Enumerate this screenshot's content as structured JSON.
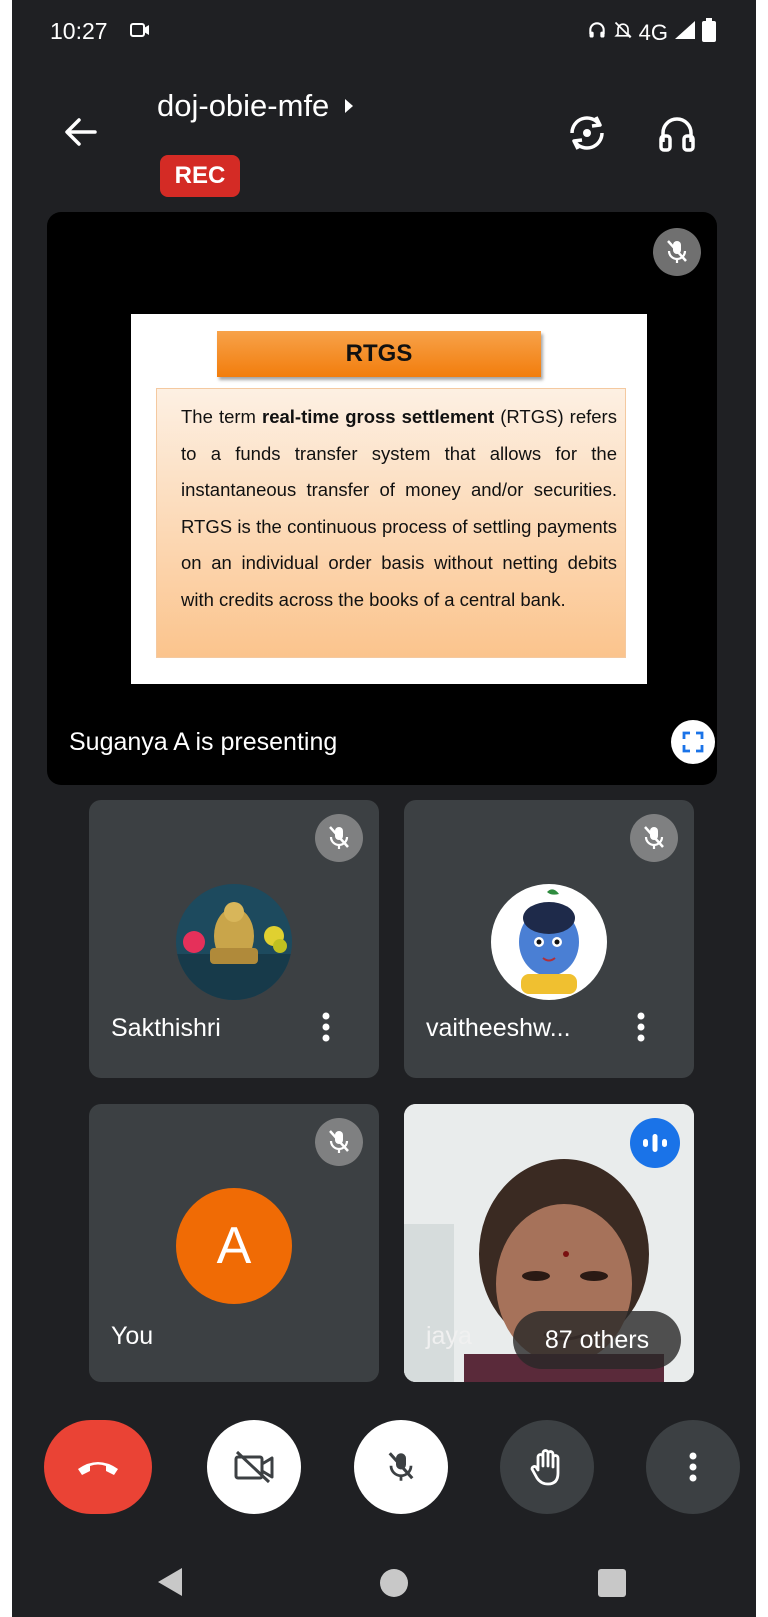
{
  "status_bar": {
    "time": "10:27",
    "network": "4G"
  },
  "header": {
    "meeting_title": "doj-obie-mfe",
    "rec_label": "REC"
  },
  "presentation": {
    "presenter_text": "Suganya A is presenting",
    "slide": {
      "title": "RTGS",
      "body_prefix": "The term ",
      "body_bold": "real-time gross settlement",
      "body_suffix": " (RTGS) refers to a funds transfer system that allows for the instantaneous transfer of money and/or securities. RTGS is the continuous process of settling payments on an individual order basis without netting debits with credits across the books of a central bank."
    }
  },
  "participants": [
    {
      "name": "Sakthishri",
      "muted": true
    },
    {
      "name": "vaitheeshw...",
      "muted": true
    },
    {
      "name": "You",
      "avatar_letter": "A",
      "muted": true
    },
    {
      "name": "jaya",
      "speaking": true
    }
  ],
  "others_label": "87 others",
  "colors": {
    "background": "#1f2023",
    "tile": "#3c4043",
    "end_call": "#ea4335",
    "rec": "#d42b25",
    "speaking": "#1a73e8",
    "avatar": "#f06b05"
  },
  "icons": [
    "back-arrow-icon",
    "chevron-right-icon",
    "camera-switch-icon",
    "headphones-icon",
    "mic-off-icon",
    "fullscreen-icon",
    "more-vert-icon",
    "audio-wave-icon",
    "call-end-icon",
    "video-off-icon",
    "hand-raise-icon"
  ]
}
